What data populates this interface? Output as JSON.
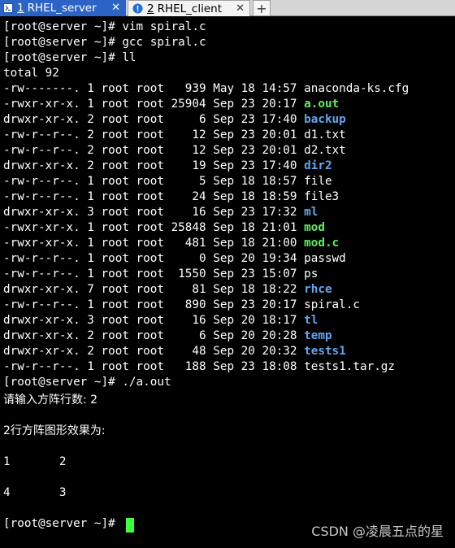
{
  "tabs": [
    {
      "number": "1",
      "title": "RHEL_server",
      "close": "✕",
      "active": true
    },
    {
      "number": "2",
      "title": "RHEL_client",
      "close": "✕",
      "active": false,
      "icon": "alert-icon"
    }
  ],
  "new_tab_label": "+",
  "colors": {
    "background": "#000000",
    "text": "#ffffff",
    "directory": "#5fa8f0",
    "executable": "#5ef15e",
    "archive": "#ff5858",
    "cursor": "#3cff3c",
    "tab_active": "#2b63c6",
    "alert_icon": "#1f6fd6"
  },
  "terminal": {
    "lines": [
      {
        "text": "[root@server ~]# vim spiral.c"
      },
      {
        "text": "[root@server ~]# gcc spiral.c"
      },
      {
        "text": "[root@server ~]# ll"
      },
      {
        "text": "total 92"
      }
    ],
    "listing": [
      {
        "info": "-rw-------. 1 root root   939 May 18 14:57 ",
        "name": "anaconda-ks.cfg",
        "kind": "normal"
      },
      {
        "info": "-rwxr-xr-x. 1 root root 25904 Sep 23 20:17 ",
        "name": "a.out",
        "kind": "exec"
      },
      {
        "info": "drwxr-xr-x. 2 root root     6 Sep 23 17:40 ",
        "name": "backup",
        "kind": "dir"
      },
      {
        "info": "-rw-r--r--. 2 root root    12 Sep 23 20:01 ",
        "name": "d1.txt",
        "kind": "normal"
      },
      {
        "info": "-rw-r--r--. 2 root root    12 Sep 23 20:01 ",
        "name": "d2.txt",
        "kind": "normal"
      },
      {
        "info": "drwxr-xr-x. 2 root root    19 Sep 23 17:40 ",
        "name": "dir2",
        "kind": "dir"
      },
      {
        "info": "-rw-r--r--. 1 root root     5 Sep 18 18:57 ",
        "name": "file",
        "kind": "normal"
      },
      {
        "info": "-rw-r--r--. 1 root root    24 Sep 18 18:59 ",
        "name": "file3",
        "kind": "normal"
      },
      {
        "info": "drwxr-xr-x. 3 root root    16 Sep 23 17:32 ",
        "name": "ml",
        "kind": "dir"
      },
      {
        "info": "-rwxr-xr-x. 1 root root 25848 Sep 18 21:01 ",
        "name": "mod",
        "kind": "exec"
      },
      {
        "info": "-rwxr-xr-x. 1 root root   481 Sep 18 21:00 ",
        "name": "mod.c",
        "kind": "exec"
      },
      {
        "info": "-rw-r--r--. 1 root root     0 Sep 20 19:34 ",
        "name": "passwd",
        "kind": "normal"
      },
      {
        "info": "-rw-r--r--. 1 root root  1550 Sep 23 15:07 ",
        "name": "ps",
        "kind": "normal"
      },
      {
        "info": "drwxr-xr-x. 7 root root    81 Sep 18 18:22 ",
        "name": "rhce",
        "kind": "dir"
      },
      {
        "info": "-rw-r--r--. 1 root root   890 Sep 23 20:17 ",
        "name": "spiral.c",
        "kind": "normal"
      },
      {
        "info": "drwxr-xr-x. 3 root root    16 Sep 20 18:17 ",
        "name": "tl",
        "kind": "dir"
      },
      {
        "info": "drwxr-xr-x. 2 root root     6 Sep 20 20:28 ",
        "name": "temp",
        "kind": "dir"
      },
      {
        "info": "drwxr-xr-x. 2 root root    48 Sep 20 20:32 ",
        "name": "tests1",
        "kind": "dir"
      },
      {
        "info": "-rw-r--r--. 1 root root   188 Sep 23 18:08 ",
        "name": "tests1.tar.gz",
        "kind": "archive"
      }
    ],
    "run_command": "[root@server ~]# ./a.out",
    "prompt_input": "请输入方阵行数: 2",
    "blank1": "",
    "result_heading": "2行方阵图形效果为:",
    "blank2": "",
    "matrix_row1": "1       2",
    "blank3": "",
    "matrix_row2": "4       3",
    "blank4": "",
    "final_prompt": "[root@server ~]# "
  },
  "watermark": "CSDN @凌晨五点的星"
}
